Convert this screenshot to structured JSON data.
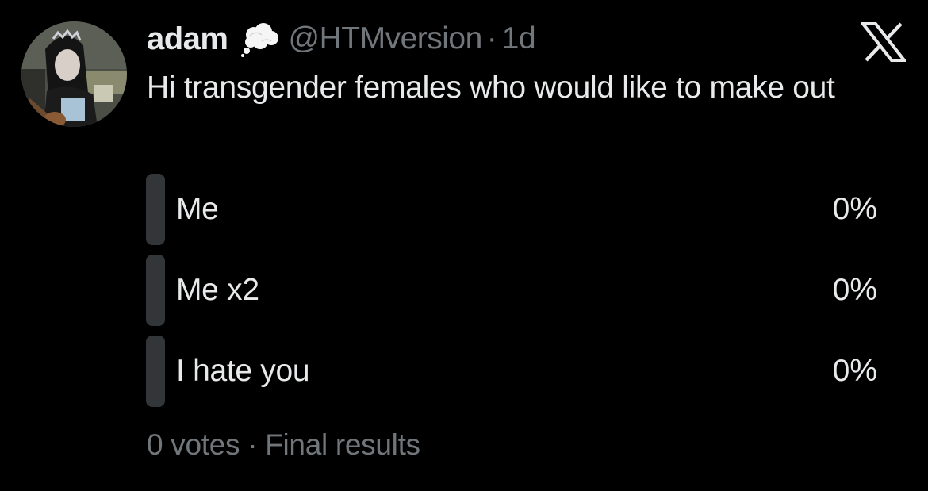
{
  "author": {
    "display_name": "adam",
    "handle": "@HTMversion",
    "separator": "·",
    "timestamp": "1d",
    "name_emoji": "thought-balloon-icon"
  },
  "brand": {
    "logo": "x-logo-icon"
  },
  "tweet": {
    "text": "Hi transgender females who would like to make out"
  },
  "poll": {
    "options": [
      {
        "label": "Me",
        "percent": "0%",
        "fraction": 0
      },
      {
        "label": "Me x2",
        "percent": "0%",
        "fraction": 0
      },
      {
        "label": "I hate you",
        "percent": "0%",
        "fraction": 0
      }
    ],
    "votes": "0 votes",
    "separator": "·",
    "status": "Final results"
  },
  "colors": {
    "background": "#000000",
    "primary_text": "#e7e9ea",
    "secondary_text": "#71767b",
    "poll_bar": "#333639"
  }
}
